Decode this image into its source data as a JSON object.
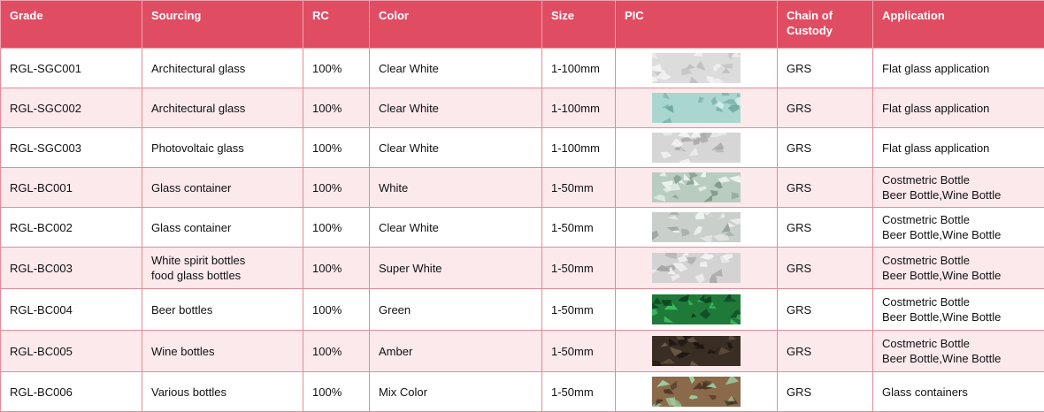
{
  "table": {
    "headers": [
      "Grade",
      "Sourcing",
      "RC",
      "Color",
      "Size",
      "PIC",
      "Chain of\nCustody",
      "Application"
    ],
    "rows": [
      {
        "grade": "RGL-SGC001",
        "sourcing": "Architectural glass",
        "rc": "100%",
        "color": "Clear White",
        "size": "1-100mm",
        "pic": {
          "icon": "clear-glass-cullet",
          "base": "#dcdcdc",
          "hi": "#f4f4f4",
          "dark": "#bdbdbd"
        },
        "custody": "GRS",
        "application": "Flat glass application"
      },
      {
        "grade": "RGL-SGC002",
        "sourcing": "Architectural glass",
        "rc": "100%",
        "color": "Clear White",
        "size": "1-100mm",
        "pic": {
          "icon": "aqua-glass-cullet",
          "base": "#a9d6cf",
          "hi": "#dff3ef",
          "dark": "#6fa9a0"
        },
        "custody": "GRS",
        "application": "Flat glass application"
      },
      {
        "grade": "RGL-SGC003",
        "sourcing": "Photovoltaic glass",
        "rc": "100%",
        "color": "Clear White",
        "size": "1-100mm",
        "pic": {
          "icon": "clear-glass-cullet",
          "base": "#d6d6d6",
          "hi": "#f2f2f2",
          "dark": "#a9a9a9"
        },
        "custody": "GRS",
        "application": "Flat glass application"
      },
      {
        "grade": "RGL-BC001",
        "sourcing": "Glass container",
        "rc": "100%",
        "color": "White",
        "size": "1-50mm",
        "pic": {
          "icon": "white-glass-cullet",
          "base": "#b9ccc0",
          "hi": "#eef5f0",
          "dark": "#7f9a88"
        },
        "custody": "GRS",
        "application": "Costmetric Bottle\nBeer Bottle,Wine Bottle"
      },
      {
        "grade": "RGL-BC002",
        "sourcing": "Glass container",
        "rc": "100%",
        "color": "Clear White",
        "size": "1-50mm",
        "pic": {
          "icon": "clear-glass-cullet",
          "base": "#c9cfcb",
          "hi": "#f1f3f2",
          "dark": "#98a19b"
        },
        "custody": "GRS",
        "application": "Costmetric Bottle\nBeer Bottle,Wine Bottle"
      },
      {
        "grade": "RGL-BC003",
        "sourcing": "White spirit bottles\nfood glass bottles",
        "rc": "100%",
        "color": "Super White",
        "size": "1-50mm",
        "pic": {
          "icon": "super-white-glass-cullet",
          "base": "#d3d3d3",
          "hi": "#f5f5f5",
          "dark": "#a5a5a5"
        },
        "custody": "GRS",
        "application": "Costmetric Bottle\nBeer Bottle,Wine Bottle"
      },
      {
        "grade": "RGL-BC004",
        "sourcing": "Beer bottles",
        "rc": "100%",
        "color": "Green",
        "size": "1-50mm",
        "pic": {
          "icon": "green-glass-cullet",
          "base": "#1f7a3a",
          "hi": "#3fbf63",
          "dark": "#0c3d1c"
        },
        "custody": "GRS",
        "application": "Costmetric Bottle\nBeer Bottle,Wine Bottle"
      },
      {
        "grade": "RGL-BC005",
        "sourcing": "Wine bottles",
        "rc": "100%",
        "color": "Amber",
        "size": "1-50mm",
        "pic": {
          "icon": "amber-glass-cullet",
          "base": "#3a2e24",
          "hi": "#6b5a47",
          "dark": "#1a130d"
        },
        "custody": "GRS",
        "application": "Costmetric Bottle\nBeer Bottle,Wine Bottle"
      },
      {
        "grade": "RGL-BC006",
        "sourcing": "Various bottles",
        "rc": "100%",
        "color": "Mix Color",
        "size": "1-50mm",
        "pic": {
          "icon": "mixed-glass-cullet",
          "base": "#8a6a4a",
          "hi": "#9fd0a4",
          "dark": "#4a3524"
        },
        "custody": "GRS",
        "application": "Glass containers"
      }
    ]
  },
  "colors": {
    "header_bg": "#e04d63",
    "row_alt_bg": "#fbe9ec",
    "border": "#e58a98"
  }
}
